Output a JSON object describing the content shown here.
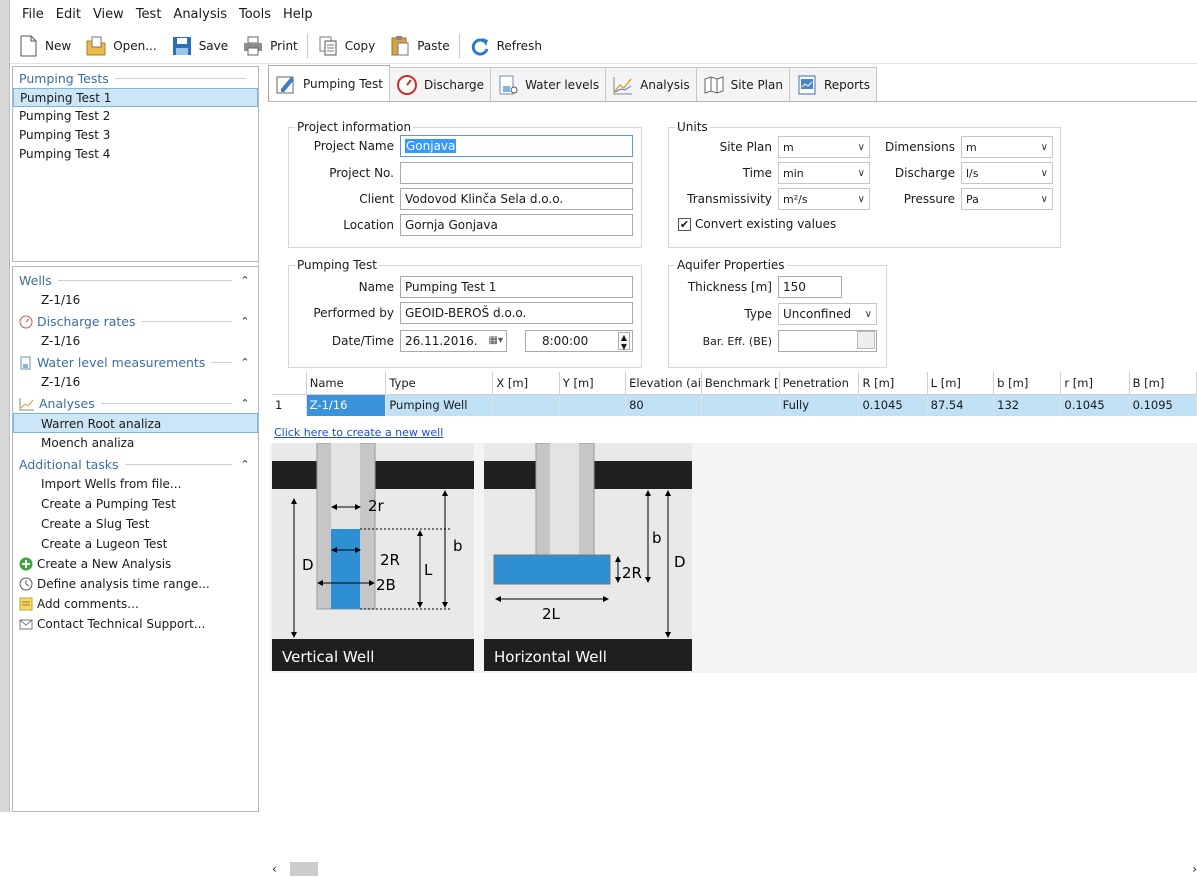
{
  "menu": [
    "File",
    "Edit",
    "View",
    "Test",
    "Analysis",
    "Tools",
    "Help"
  ],
  "toolbar": {
    "new": "New",
    "open": "Open...",
    "save": "Save",
    "print": "Print",
    "copy": "Copy",
    "paste": "Paste",
    "refresh": "Refresh"
  },
  "left": {
    "pumping_tests_title": "Pumping Tests",
    "pumping_tests": [
      "Pumping Test 1",
      "Pumping Test 2",
      "Pumping Test 3",
      "Pumping Test 4"
    ],
    "wells_title": "Wells",
    "wells_item": "Z-1/16",
    "discharge_title": "Discharge rates",
    "discharge_item": "Z-1/16",
    "water_title": "Water level measurements",
    "water_item": "Z-1/16",
    "analyses_title": "Analyses",
    "analyses": [
      "Warren Root analiza",
      "Moench analiza"
    ],
    "additional_title": "Additional tasks",
    "tasks": [
      "Import Wells from file...",
      "Create a Pumping Test",
      "Create a Slug Test",
      "Create a Lugeon Test"
    ],
    "icon_tasks": [
      "Create a New Analysis",
      "Define analysis time range...",
      "Add comments...",
      "Contact Technical Support..."
    ]
  },
  "tabs": [
    "Pumping Test",
    "Discharge",
    "Water levels",
    "Analysis",
    "Site Plan",
    "Reports"
  ],
  "project": {
    "legend": "Project information",
    "name_label": "Project Name",
    "name": "Gonjava",
    "no_label": "Project No.",
    "no": "",
    "client_label": "Client",
    "client": "Vodovod Klinča Sela d.o.o.",
    "location_label": "Location",
    "location": "Gornja Gonjava"
  },
  "units": {
    "legend": "Units",
    "site_plan_label": "Site Plan",
    "site_plan": "m",
    "time_label": "Time",
    "time": "min",
    "trans_label": "Transmissivity",
    "trans": "m²/s",
    "dim_label": "Dimensions",
    "dim": "m",
    "discharge_label": "Discharge",
    "discharge": "l/s",
    "pressure_label": "Pressure",
    "pressure": "Pa",
    "convert_label": "Convert existing values"
  },
  "pumping": {
    "legend": "Pumping Test",
    "name_label": "Name",
    "name": "Pumping Test 1",
    "performed_label": "Performed by",
    "performed": "GEOID-BEROŠ d.o.o.",
    "date_label": "Date/Time",
    "date": "26.11.2016.",
    "time": "8:00:00"
  },
  "aquifer": {
    "legend": "Aquifer Properties",
    "thickness_label": "Thickness [m]",
    "thickness": "150",
    "type_label": "Type",
    "type": "Unconfined",
    "bar_label": "Bar. Eff. (BE)",
    "bar": ""
  },
  "grid": {
    "headers": [
      "Name",
      "Type",
      "X [m]",
      "Y [m]",
      "Elevation (ai",
      "Benchmark [",
      "Penetration",
      "R [m]",
      "L [m]",
      "b [m]",
      "r [m]",
      "B [m]"
    ],
    "row_num": "1",
    "row": [
      "Z-1/16",
      "Pumping Well",
      "",
      "",
      "80",
      "",
      "Fully",
      "0.1045",
      "87.54",
      "132",
      "0.1045",
      "0.1095"
    ]
  },
  "new_well_link": "Click here to create a new well",
  "diagram": {
    "vertical_title": "Vertical Well",
    "horizontal_title": "Horizontal Well",
    "v_labels": {
      "r": "2r",
      "R": "2R",
      "B": "2B",
      "D": "D",
      "L": "L",
      "b": "b"
    },
    "h_labels": {
      "b": "b",
      "D": "D",
      "R": "2R",
      "L": "2L"
    }
  }
}
